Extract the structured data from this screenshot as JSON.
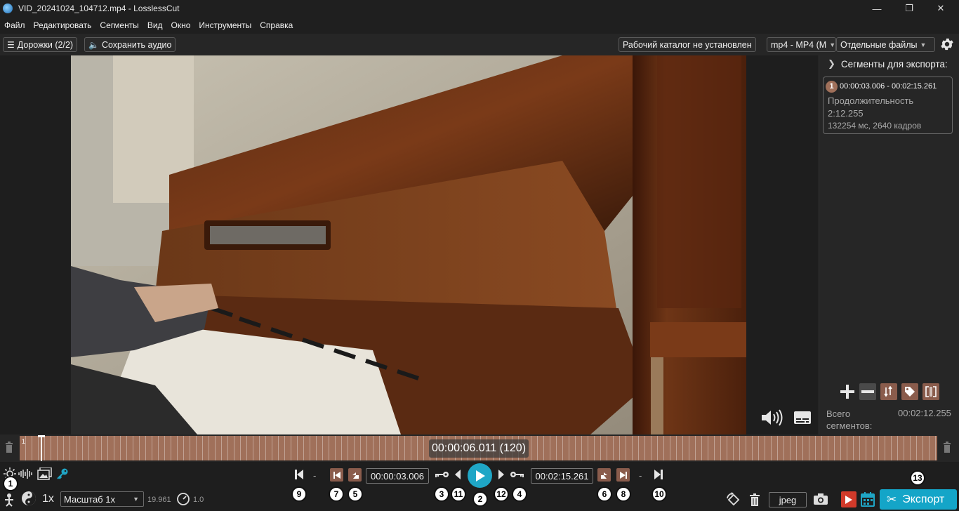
{
  "window": {
    "title": "VID_20241024_104712.mp4 - LosslessCut",
    "minimize": "—",
    "maximize": "❐",
    "close": "✕"
  },
  "menu": [
    "Файл",
    "Редактировать",
    "Сегменты",
    "Вид",
    "Окно",
    "Инструменты",
    "Справка"
  ],
  "toolbar": {
    "tracks_label": "Дорожки (2/2)",
    "save_audio_label": "Сохранить аудио",
    "workdir_label": "Рабочий каталог не установлен",
    "format_value": "mp4 - MP4 (M",
    "output_mode_value": "Отдельные файлы"
  },
  "segments_panel": {
    "header": "Сегменты для экспорта:",
    "segments": [
      {
        "number": "1",
        "range": "00:00:03.006 - 00:02:15.261",
        "duration_label": "Продолжительность",
        "duration": "2:12.255",
        "duration_ms": "132254 мс, 2640 кадров"
      }
    ],
    "total_label": "Всего сегментов:",
    "total_value": "00:02:12.255"
  },
  "timeline": {
    "segment_number": "1",
    "current_time": "00:00:06.011 (120)"
  },
  "controls": {
    "cut_start": "00:00:03.006",
    "cut_end": "00:02:15.261",
    "separator": "-",
    "speed": "1x",
    "zoom": "Масштаб 1x",
    "zoom_value": "19.961",
    "speed_value": "1.0",
    "capture_format": "jpeg",
    "export_label": "Экспорт"
  },
  "annotations": [
    "1",
    "2",
    "3",
    "4",
    "5",
    "6",
    "7",
    "8",
    "9",
    "10",
    "11",
    "12",
    "13"
  ],
  "colors": {
    "accent": "#1fa6c6",
    "segment": "#a0705a",
    "export": "#14a5c8"
  }
}
